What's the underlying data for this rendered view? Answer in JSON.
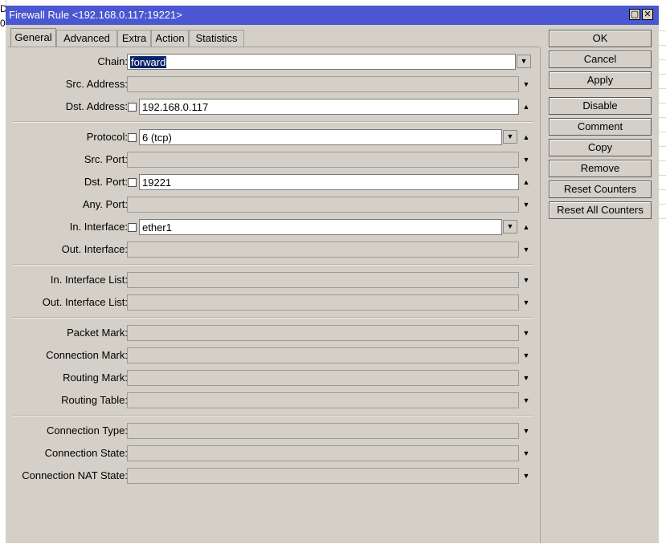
{
  "window": {
    "title": "Firewall Rule <192.168.0.117:19221>"
  },
  "background": {
    "left_text": "D",
    "left_text2": "0"
  },
  "tabs": [
    {
      "label": "General",
      "active": true
    },
    {
      "label": "Advanced",
      "active": false
    },
    {
      "label": "Extra",
      "active": false
    },
    {
      "label": "Action",
      "active": false
    },
    {
      "label": "Statistics",
      "active": false
    }
  ],
  "form": {
    "chain": {
      "label": "Chain:",
      "value": "forward"
    },
    "src_address": {
      "label": "Src. Address:",
      "value": ""
    },
    "dst_address": {
      "label": "Dst. Address:",
      "value": "192.168.0.117",
      "negate": false
    },
    "protocol": {
      "label": "Protocol:",
      "value": "6 (tcp)",
      "negate": false
    },
    "src_port": {
      "label": "Src. Port:",
      "value": ""
    },
    "dst_port": {
      "label": "Dst. Port:",
      "value": "19221",
      "negate": false
    },
    "any_port": {
      "label": "Any. Port:",
      "value": ""
    },
    "in_interface": {
      "label": "In. Interface:",
      "value": "ether1",
      "negate": false
    },
    "out_interface": {
      "label": "Out. Interface:",
      "value": ""
    },
    "in_interface_list": {
      "label": "In. Interface List:",
      "value": ""
    },
    "out_interface_list": {
      "label": "Out. Interface List:",
      "value": ""
    },
    "packet_mark": {
      "label": "Packet Mark:",
      "value": ""
    },
    "connection_mark": {
      "label": "Connection Mark:",
      "value": ""
    },
    "routing_mark": {
      "label": "Routing Mark:",
      "value": ""
    },
    "routing_table": {
      "label": "Routing Table:",
      "value": ""
    },
    "connection_type": {
      "label": "Connection Type:",
      "value": ""
    },
    "connection_state": {
      "label": "Connection State:",
      "value": ""
    },
    "connection_nat_state": {
      "label": "Connection NAT State:",
      "value": ""
    }
  },
  "buttons": {
    "ok": "OK",
    "cancel": "Cancel",
    "apply": "Apply",
    "disable": "Disable",
    "comment": "Comment",
    "copy": "Copy",
    "remove": "Remove",
    "reset_counters": "Reset Counters",
    "reset_all_counters": "Reset All Counters"
  },
  "icons": {
    "restore": "restore-icon",
    "close": "close-icon",
    "dropdown": "dropdown-arrow-icon",
    "expand": "expand-arrow-icon",
    "collapse": "collapse-arrow-icon"
  }
}
